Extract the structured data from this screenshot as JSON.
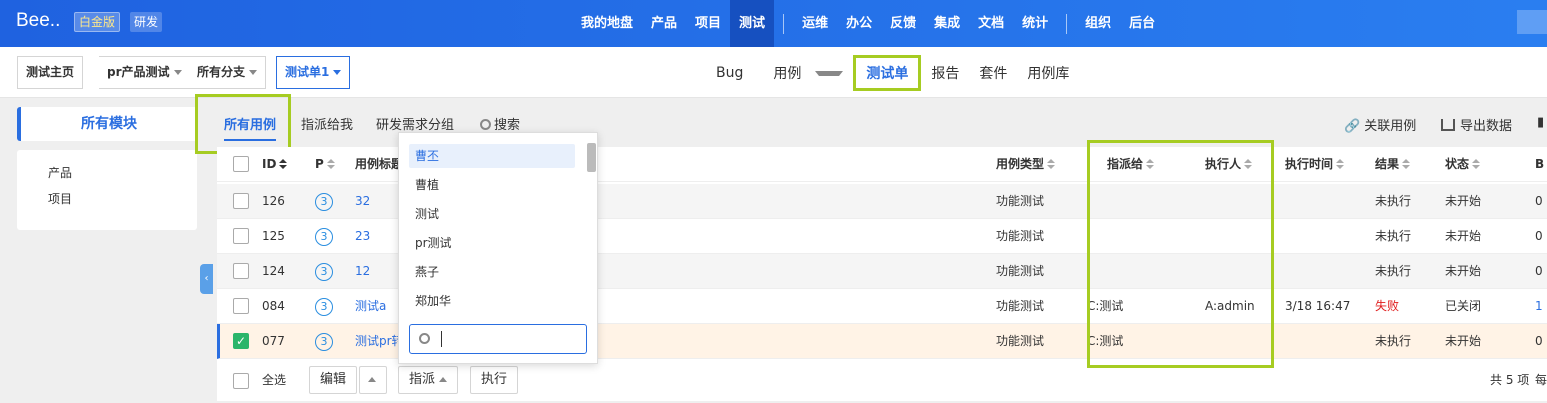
{
  "app": {
    "logo": "Bee..",
    "edition_badge": "白金版",
    "mode_badge": "研发"
  },
  "topnav": {
    "items": [
      "我的地盘",
      "产品",
      "项目",
      "测试",
      "运维",
      "办公",
      "反馈",
      "集成",
      "文档",
      "统计",
      "组织",
      "后台"
    ],
    "active": "测试"
  },
  "breadcrumb": {
    "home": "测试主页",
    "product": "pr产品测试",
    "branch": "所有分支",
    "current": "测试单1"
  },
  "subnav": {
    "bug": "Bug",
    "cases": "用例",
    "testtask": "测试单",
    "report": "报告",
    "suite": "套件",
    "caselib": "用例库"
  },
  "sidebar": {
    "title": "所有模块",
    "items": [
      "产品",
      "项目"
    ]
  },
  "tabs": {
    "all": "所有用例",
    "assigned": "指派给我",
    "group": "研发需求分组",
    "search": "搜索"
  },
  "actions": {
    "link_cases": "关联用例",
    "export": "导出数据"
  },
  "table": {
    "headers": {
      "id": "ID",
      "pri": "P",
      "title": "用例标题",
      "type": "用例类型",
      "assigned": "指派给",
      "executor": "执行人",
      "exec_time": "执行时间",
      "result": "结果",
      "status": "状态",
      "bugs": "B"
    },
    "rows": [
      {
        "id": "126",
        "pri": "3",
        "title": "32",
        "type": "功能测试",
        "assigned": "",
        "executor": "",
        "exec_time": "",
        "result": "未执行",
        "status": "未开始",
        "bugs": "0"
      },
      {
        "id": "125",
        "pri": "3",
        "title": "23",
        "type": "功能测试",
        "assigned": "",
        "executor": "",
        "exec_time": "",
        "result": "未执行",
        "status": "未开始",
        "bugs": "0"
      },
      {
        "id": "124",
        "pri": "3",
        "title": "12",
        "type": "功能测试",
        "assigned": "",
        "executor": "",
        "exec_time": "",
        "result": "未执行",
        "status": "未开始",
        "bugs": "0"
      },
      {
        "id": "084",
        "pri": "3",
        "title": "测试a",
        "type": "功能测试",
        "assigned": "C:测试",
        "executor": "A:admin",
        "exec_time": "3/18 16:47",
        "result": "失败",
        "status": "已关闭",
        "bugs": "1"
      },
      {
        "id": "077",
        "pri": "3",
        "title": "测试pr转",
        "type": "功能测试",
        "assigned": "C:测试",
        "executor": "",
        "exec_time": "",
        "result": "未执行",
        "status": "未开始",
        "bugs": "0"
      }
    ]
  },
  "footer": {
    "select_all": "全选",
    "edit": "编辑",
    "assign": "指派",
    "execute": "执行",
    "total": "共 5 项",
    "per_page": "每"
  },
  "assign_dropdown": {
    "options": [
      "曹丕",
      "曹植",
      "测试",
      "pr测试",
      "燕子",
      "郑加华"
    ],
    "highlighted": "曹丕",
    "search_value": ""
  }
}
